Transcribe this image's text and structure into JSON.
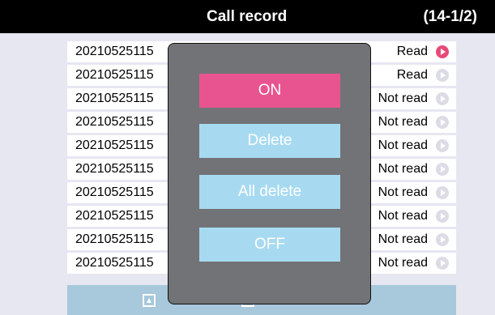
{
  "header": {
    "title": "Call record",
    "page_count": "(14-1/2)"
  },
  "records": [
    {
      "name": "20210525115",
      "status": "Read",
      "active": true
    },
    {
      "name": "20210525115",
      "status": "Read",
      "active": false
    },
    {
      "name": "20210525115",
      "status": "Not read",
      "active": false
    },
    {
      "name": "20210525115",
      "status": "Not read",
      "active": false
    },
    {
      "name": "20210525115",
      "status": "Not read",
      "active": false
    },
    {
      "name": "20210525115",
      "status": "Not read",
      "active": false
    },
    {
      "name": "20210525115",
      "status": "Not read",
      "active": false
    },
    {
      "name": "20210525115",
      "status": "Not read",
      "active": false
    },
    {
      "name": "20210525115",
      "status": "Not read",
      "active": false
    },
    {
      "name": "20210525115",
      "status": "Not read",
      "active": false
    }
  ],
  "popup": {
    "on_label": "ON",
    "delete_label": "Delete",
    "all_delete_label": "All delete",
    "off_label": "OFF"
  },
  "footer": {
    "up_icon": "up-arrow-icon",
    "down_icon": "down-arrow-icon",
    "back_icon": "back-arrow-icon"
  },
  "colors": {
    "header_bg": "#000000",
    "accent": "#e8548f",
    "button_bg": "#a7daf1",
    "popup_bg": "#727377",
    "footer_bg": "#a8c8dc"
  }
}
